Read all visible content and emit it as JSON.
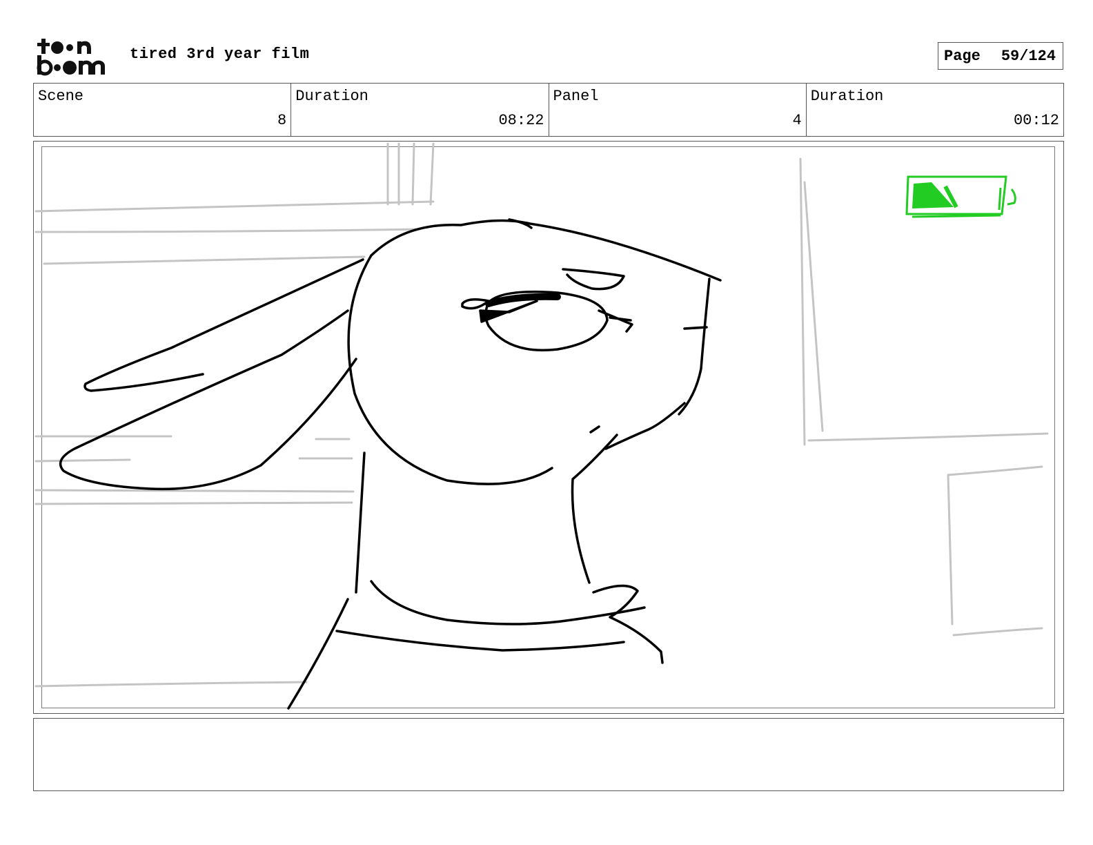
{
  "header": {
    "logo_top": "to●n",
    "logo_bottom": "b●●m",
    "project_title": "tired 3rd year film",
    "page_label": "Page",
    "page_number": "59/124"
  },
  "info": {
    "scene_label": "Scene",
    "scene_value": "8",
    "scene_duration_label": "Duration",
    "scene_duration_value": "08:22",
    "panel_label": "Panel",
    "panel_value": "4",
    "panel_duration_label": "Duration",
    "panel_duration_value": "00:12"
  },
  "panel": {
    "drawing": "sketch-rabbit-looking-up",
    "battery_color": "#22cc22",
    "line_color": "#000000",
    "background_line_color": "#c4c4c4"
  },
  "notes": {
    "text": ""
  }
}
